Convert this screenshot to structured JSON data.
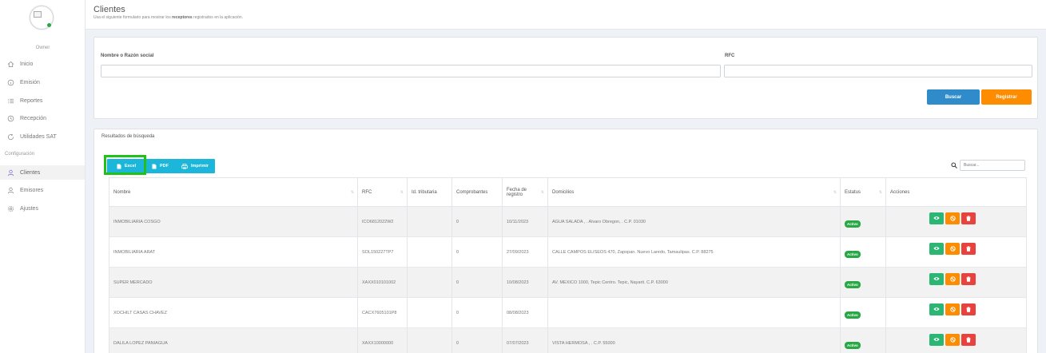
{
  "sidebar": {
    "role": "Owner",
    "items": [
      {
        "label": "Inicio",
        "icon": "home-icon"
      },
      {
        "label": "Emisión",
        "icon": "info-circle-icon"
      },
      {
        "label": "Reportes",
        "icon": "list-icon"
      },
      {
        "label": "Recepción",
        "icon": "clock-icon"
      },
      {
        "label": "Utilidades SAT",
        "icon": "refresh-icon"
      }
    ],
    "section_label": "Configuración",
    "config_items": [
      {
        "label": "Clientes",
        "icon": "user-icon",
        "active": true
      },
      {
        "label": "Emisores",
        "icon": "user-icon"
      },
      {
        "label": "Ajustes",
        "icon": "gear-icon"
      }
    ]
  },
  "header": {
    "title": "Clientes",
    "subtitle_pre": "Usa el siguiente formulario para mostrar los ",
    "subtitle_bold": "receptores",
    "subtitle_post": " registrados en la aplicación."
  },
  "form": {
    "name_label": "Nombre o Razón social",
    "name_value": "",
    "rfc_label": "RFC",
    "rfc_value": "",
    "search_button": "Buscar",
    "register_button": "Registrar"
  },
  "results": {
    "title": "Resultados de búsqueda",
    "export": {
      "excel": "Excel",
      "pdf": "PDF",
      "print": "Imprimir"
    },
    "search_placeholder": "Buscar...",
    "columns": [
      "Nombre",
      "RFC",
      "Id. tributaria",
      "Comprobantes",
      "Fecha de registro",
      "Domicilios",
      "Estatus",
      "Acciones"
    ],
    "rows": [
      {
        "nombre": "INMOBILIARIA COSGO",
        "rfc": "ICO6812022W2",
        "id_trib": "",
        "comprobantes": "0",
        "fecha": "10/11/2023",
        "domicilio": "AGUA SALADA , . Alvaro Obregon, . C.P. 01030",
        "estatus": "Activo"
      },
      {
        "nombre": "INMOBILIARIA ARAT",
        "rfc": "SOL150227TP7",
        "id_trib": "",
        "comprobantes": "0",
        "fecha": "27/09/2023",
        "domicilio": "CALLE CAMPOS ELISEOS 470, Zapopan. Nuevo Laredo, Tamaulipas. C.P. 88275",
        "estatus": "Activo"
      },
      {
        "nombre": "SUPER MERCADO",
        "rfc": "XAXX010101002",
        "id_trib": "",
        "comprobantes": "0",
        "fecha": "10/08/2023",
        "domicilio": "AV. MEXICO 1000, Tepic Centro. Tepic, Nayarit. C.P. 63000",
        "estatus": "Activo"
      },
      {
        "nombre": "XOCHILT CASAS CHAVEZ",
        "rfc": "CACX7605101P8",
        "id_trib": "",
        "comprobantes": "0",
        "fecha": "08/08/2023",
        "domicilio": "",
        "estatus": "Activo"
      },
      {
        "nombre": "DALILA LOPEZ PANIAGUA",
        "rfc": "XAXX10000000",
        "id_trib": "",
        "comprobantes": "0",
        "fecha": "07/07/2023",
        "domicilio": "VISTA HERMOSA , . C.P. 55000",
        "estatus": "Activo"
      }
    ]
  },
  "colors": {
    "accent": "#1bb6d9",
    "primary": "#2f8bc9",
    "warning": "#fd8c00",
    "success": "#28a745",
    "danger": "#e8423e",
    "highlight": "#22c01a"
  }
}
